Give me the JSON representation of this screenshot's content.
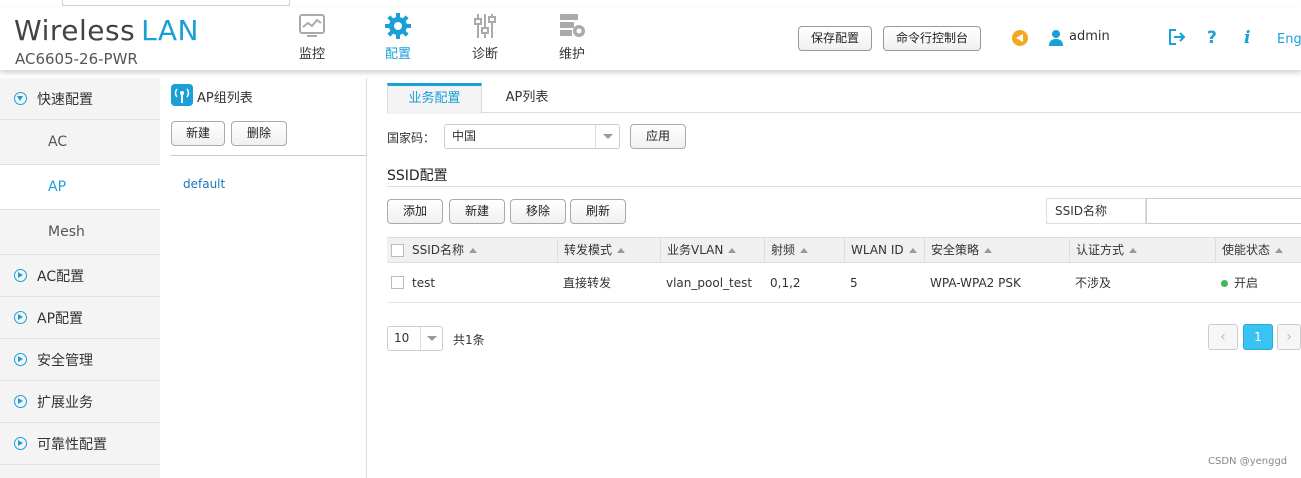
{
  "header": {
    "brand_main": "Wireless",
    "brand_accent": "LAN",
    "model": "AC6605-26-PWR",
    "nav": [
      {
        "label": "监控",
        "icon": "monitor-icon"
      },
      {
        "label": "配置",
        "icon": "gear-icon",
        "active": true
      },
      {
        "label": "诊断",
        "icon": "sliders-icon"
      },
      {
        "label": "维护",
        "icon": "server-gear-icon"
      }
    ],
    "save_label": "保存配置",
    "cli_label": "命令行控制台",
    "username": "admin",
    "help_glyph": "?",
    "info_glyph": "i",
    "language": "Eng"
  },
  "sidebar": {
    "quick_config": "快速配置",
    "sub_items": [
      "AC",
      "AP",
      "Mesh"
    ],
    "active_sub": "AP",
    "sections": [
      "AC配置",
      "AP配置",
      "安全管理",
      "扩展业务",
      "可靠性配置"
    ]
  },
  "group_panel": {
    "title": "AP组列表",
    "new_label": "新建",
    "delete_label": "删除",
    "groups": [
      "default"
    ]
  },
  "main": {
    "tabs": [
      "业务配置",
      "AP列表"
    ],
    "active_tab": "业务配置",
    "country_label": "国家码：",
    "country_value": "中国",
    "apply_label": "应用",
    "section_title": "SSID配置",
    "toolbar": {
      "add": "添加",
      "new": "新建",
      "remove": "移除",
      "refresh": "刷新"
    },
    "search_label": "SSID名称",
    "search_value": "",
    "columns": [
      "SSID名称",
      "转发模式",
      "业务VLAN",
      "射频",
      "WLAN ID",
      "安全策略",
      "认证方式",
      "使能状态"
    ],
    "rows": [
      {
        "ssid": "test",
        "forward": "直接转发",
        "vlan": "vlan_pool_test",
        "radio": "0,1,2",
        "wlan_id": "5",
        "security": "WPA-WPA2 PSK",
        "auth": "不涉及",
        "status": "开启"
      }
    ],
    "page_size": "10",
    "total_text": "共1条",
    "current_page": "1"
  },
  "colors": {
    "accent": "#1a9fd6",
    "status_on": "#3cba54",
    "page_current": "#38c3f1",
    "notice": "#f5a623"
  },
  "watermark": "CSDN @yenggd"
}
